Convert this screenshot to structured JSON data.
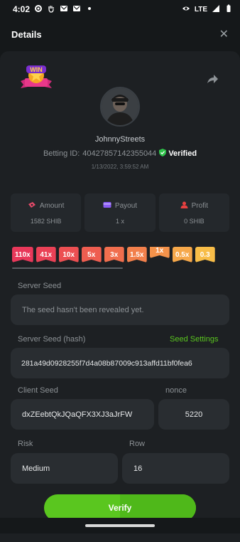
{
  "status_bar": {
    "time": "4:02",
    "network": "LTE"
  },
  "header": {
    "title": "Details"
  },
  "bet": {
    "username": "JohnnyStreets",
    "betting_id_label": "Betting ID:",
    "betting_id": "40427857142355044",
    "verified_label": "Verified",
    "date": "1/13/2022, 3:59:52 AM"
  },
  "stats": [
    {
      "label": "Amount",
      "value": "1582 SHIB",
      "icon": "money-icon",
      "color": "#e84a6a"
    },
    {
      "label": "Payout",
      "value": "1 x",
      "icon": "wallet-icon",
      "color": "#8b5cf6"
    },
    {
      "label": "Profit",
      "value": "0 SHIB",
      "icon": "user-icon",
      "color": "#e84040"
    }
  ],
  "multipliers": [
    {
      "label": "110x",
      "color": "#e8385a"
    },
    {
      "label": "41x",
      "color": "#ea4156"
    },
    {
      "label": "10x",
      "color": "#ec4f52"
    },
    {
      "label": "5x",
      "color": "#ee5d50"
    },
    {
      "label": "3x",
      "color": "#f06e4e"
    },
    {
      "label": "1.5x",
      "color": "#f2804c"
    },
    {
      "label": "1x",
      "color": "#f4924a",
      "selected": true
    },
    {
      "label": "0.5x",
      "color": "#f6a84a"
    },
    {
      "label": "0.3",
      "color": "#f8bd48"
    }
  ],
  "server_seed": {
    "label": "Server Seed",
    "value": "The seed hasn't been revealed yet."
  },
  "server_seed_hash": {
    "label": "Server Seed (hash)",
    "link": "Seed Settings",
    "value": "281a49d0928255f7d4a08b87009c913affd11bf0fea6"
  },
  "client_seed": {
    "label": "Client Seed",
    "value": "dxZEebtQkJQaQFX3XJ3aJrFW"
  },
  "nonce": {
    "label": "nonce",
    "value": "5220"
  },
  "risk": {
    "label": "Risk",
    "value": "Medium"
  },
  "row": {
    "label": "Row",
    "value": "16"
  },
  "verify_label": "Verify",
  "colors": {
    "accent": "#5ac61f",
    "verified": "#2fc24a",
    "background": "#15181a",
    "card": "#1d2023",
    "field": "#292d31"
  }
}
